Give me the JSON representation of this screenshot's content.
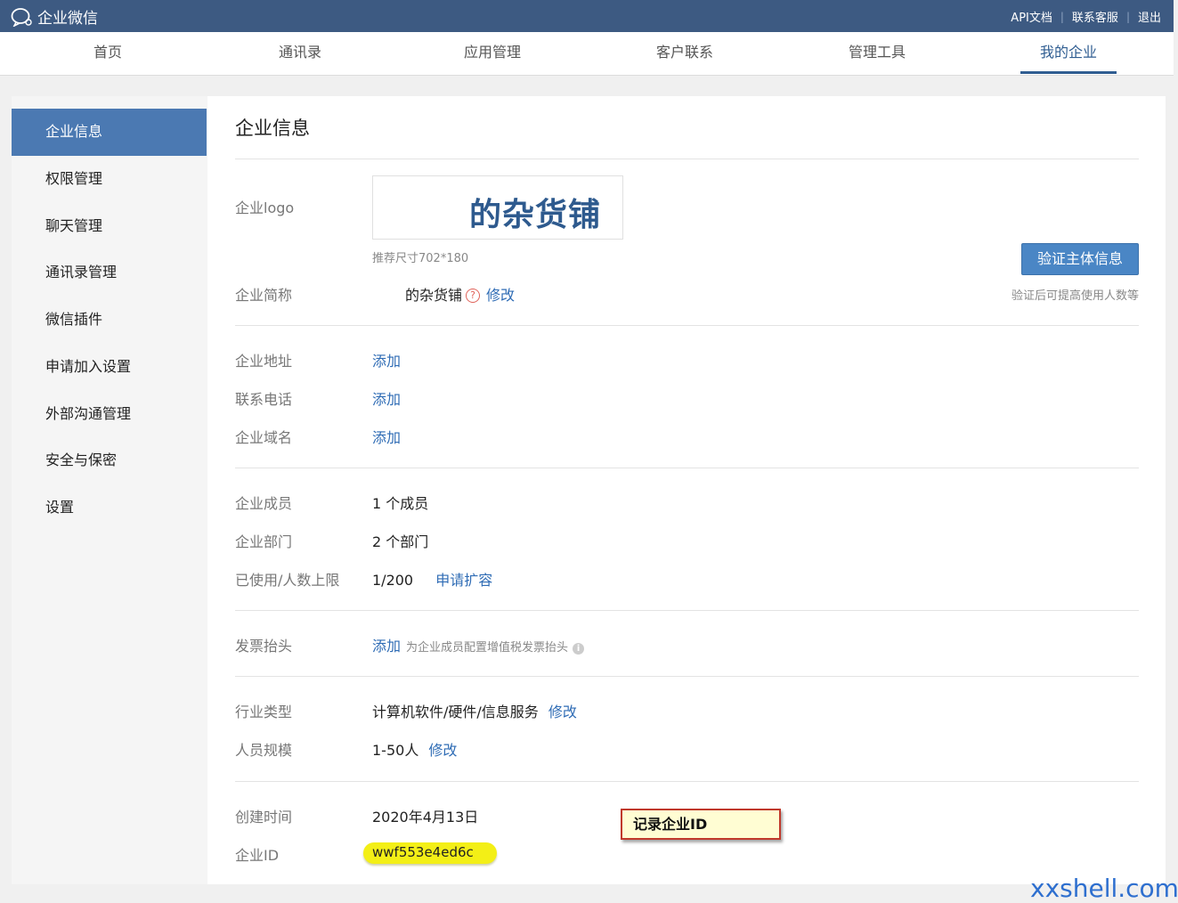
{
  "app": {
    "brand": "企业微信",
    "links": [
      "API文档",
      "联系客服",
      "退出"
    ]
  },
  "nav": {
    "tabs": [
      "首页",
      "通讯录",
      "应用管理",
      "客户联系",
      "管理工具",
      "我的企业"
    ],
    "active": "我的企业"
  },
  "sidebar": {
    "items": [
      "企业信息",
      "权限管理",
      "聊天管理",
      "通讯录管理",
      "微信插件",
      "申请加入设置",
      "外部沟通管理",
      "安全与保密",
      "设置"
    ],
    "active": "企业信息"
  },
  "main": {
    "title": "企业信息",
    "logo": {
      "label": "企业logo",
      "text": "的杂货铺",
      "hint": "推荐尺寸702*180"
    },
    "verify": {
      "button": "验证主体信息",
      "note": "验证后可提高使用人数等"
    },
    "short_name": {
      "label": "企业简称",
      "value": "的杂货铺",
      "action": "修改"
    },
    "address": {
      "label": "企业地址",
      "action": "添加"
    },
    "phone": {
      "label": "联系电话",
      "action": "添加"
    },
    "domain": {
      "label": "企业域名",
      "action": "添加"
    },
    "members": {
      "label": "企业成员",
      "value": "1 个成员"
    },
    "departments": {
      "label": "企业部门",
      "value": "2 个部门"
    },
    "usage": {
      "label": "已使用/人数上限",
      "value": "1/200",
      "action": "申请扩容"
    },
    "invoice": {
      "label": "发票抬头",
      "action": "添加",
      "note": "为企业成员配置增值税发票抬头"
    },
    "industry": {
      "label": "行业类型",
      "value": "计算机软件/硬件/信息服务",
      "action": "修改"
    },
    "scale": {
      "label": "人员规模",
      "value": "1-50人",
      "action": "修改"
    },
    "created": {
      "label": "创建时间",
      "value": "2020年4月13日"
    },
    "corp_id": {
      "label": "企业ID",
      "value": "wwf553e4ed6c"
    }
  },
  "annotation": {
    "callout": "记录企业ID"
  },
  "watermark": "xxshell.com",
  "colors": {
    "topbar": "#3d5a82",
    "accent": "#4b79b2",
    "link": "#2f6cb5"
  }
}
